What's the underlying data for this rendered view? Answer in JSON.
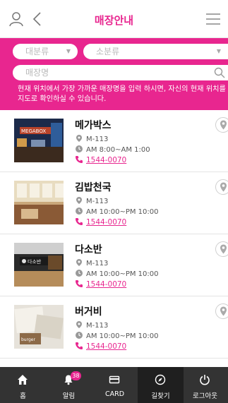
{
  "header": {
    "title": "매장안내",
    "accent_color": "#e8268f",
    "icons": [
      "user-icon",
      "back-icon",
      "menu-icon"
    ]
  },
  "search": {
    "category_major": "대분류",
    "category_minor": "소분류",
    "name_placeholder": "매장명",
    "help_text": "현재 위치에서 가장 가까운 매장명을 입력 하시면, 자신의 현재 위치를 지도로 확인하실 수 있습니다."
  },
  "stores": [
    {
      "name": "메가박스",
      "location": "M-113",
      "hours": "AM 8:00~AM 1:00",
      "phone": "1544-0070",
      "image": "megabox-photo"
    },
    {
      "name": "김밥천국",
      "location": "M-113",
      "hours": "AM 10:00~PM 10:00",
      "phone": "1544-0070",
      "image": "kimbap-photo"
    },
    {
      "name": "다소반",
      "location": "M-113",
      "hours": "AM 10:00~PM 10:00",
      "phone": "1544-0070",
      "image": "dasoban-photo"
    },
    {
      "name": "버거비",
      "location": "M-113",
      "hours": "AM 10:00~PM 10:00",
      "phone": "1544-0070",
      "image": "burger-photo"
    }
  ],
  "nav": {
    "items": [
      {
        "label": "홈",
        "icon": "home-icon"
      },
      {
        "label": "알림",
        "icon": "bell-icon",
        "badge": "38"
      },
      {
        "label": "CARD",
        "icon": "card-icon"
      },
      {
        "label": "길찾기",
        "icon": "compass-icon"
      },
      {
        "label": "로그아웃",
        "icon": "power-icon"
      }
    ],
    "active": "길찾기",
    "bar_color": "#333333"
  }
}
